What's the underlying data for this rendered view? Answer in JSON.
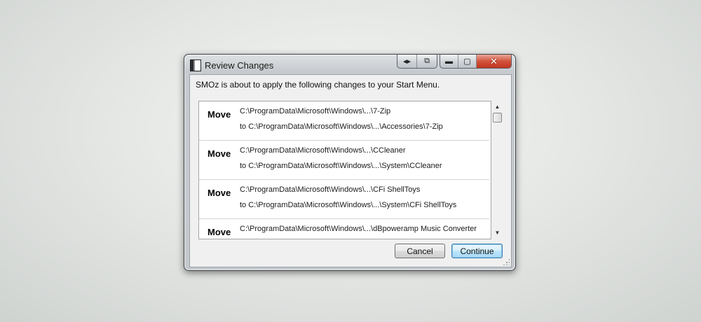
{
  "window": {
    "title": "Review Changes"
  },
  "titlebar_buttons": {
    "extra_1": "◂▸",
    "extra_2": "⧉",
    "minimize": "▬",
    "maximize": "▢",
    "close": "✕"
  },
  "intro_text": "SMOz is about to apply the following changes to your Start Menu.",
  "changes": [
    {
      "action": "Move",
      "from": "C:\\ProgramData\\Microsoft\\Windows\\...\\7-Zip",
      "to": "to C:\\ProgramData\\Microsoft\\Windows\\...\\Accessories\\7-Zip"
    },
    {
      "action": "Move",
      "from": "C:\\ProgramData\\Microsoft\\Windows\\...\\CCleaner",
      "to": "to C:\\ProgramData\\Microsoft\\Windows\\...\\System\\CCleaner"
    },
    {
      "action": "Move",
      "from": "C:\\ProgramData\\Microsoft\\Windows\\...\\CFi ShellToys",
      "to": "to C:\\ProgramData\\Microsoft\\Windows\\...\\System\\CFi ShellToys"
    },
    {
      "action": "Move",
      "from": "C:\\ProgramData\\Microsoft\\Windows\\...\\dBpoweramp Music Converter",
      "to": ""
    }
  ],
  "scrollbar": {
    "up_arrow": "▲",
    "down_arrow": "▼"
  },
  "buttons": {
    "cancel": "Cancel",
    "continue": "Continue"
  },
  "colors": {
    "close_button": "#c7412a",
    "default_button_border": "#3c7fb1"
  }
}
